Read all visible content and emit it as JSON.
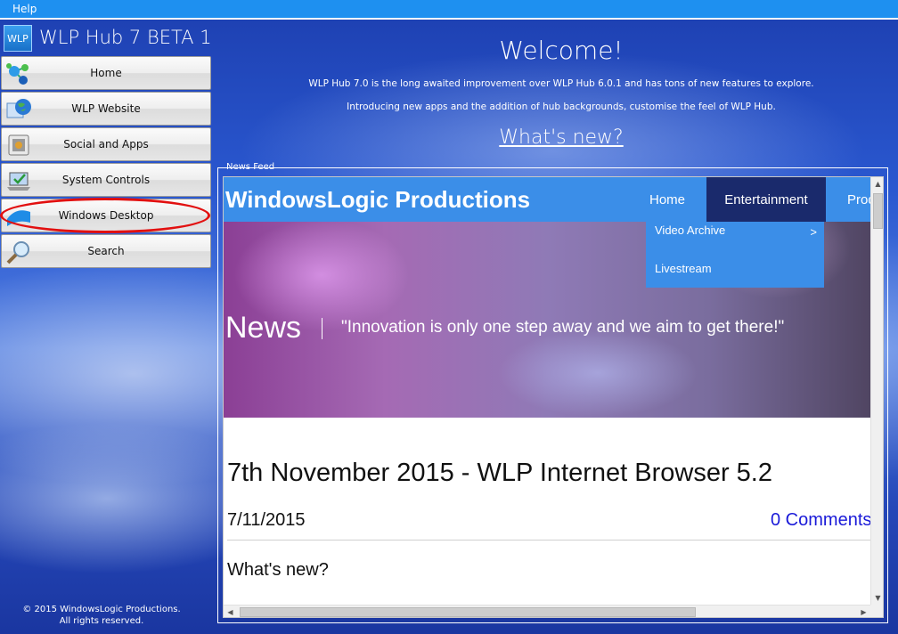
{
  "menu": {
    "help": "Help"
  },
  "app": {
    "logo_text": "WLP",
    "title": "WLP Hub 7 BETA 1"
  },
  "nav": {
    "home": "Home",
    "website": "WLP Website",
    "social": "Social and Apps",
    "system": "System Controls",
    "desktop": "Windows Desktop",
    "search": "Search"
  },
  "footer": {
    "line1": "© 2015 WindowsLogic Productions.",
    "line2": "All rights reserved."
  },
  "welcome": {
    "title": "Welcome!",
    "line1": "WLP Hub 7.0 is the long awaited improvement over WLP Hub 6.0.1 and has tons of new features to explore.",
    "line2": "Introducing new apps and the addition of hub backgrounds, customise the feel of WLP Hub.",
    "link": "What's new?"
  },
  "newsfeed": {
    "label": "News Feed",
    "site": {
      "brand": "WindowsLogic Productions",
      "tabs": [
        "Home",
        "Entertainment",
        "Prod"
      ],
      "dropdown": [
        "Video Archive",
        "Livestream"
      ],
      "dropdown_arrow": ">",
      "hero_title": "News",
      "hero_quote": "\"Innovation is only one step away and we aim to get there!\"",
      "article_title": "7th November 2015 - WLP Internet Browser 5.2",
      "article_date": "7/11/2015",
      "article_comments": "0 Comments",
      "article_sub": "What's new?"
    }
  },
  "colors": {
    "menubar": "#1e90f0",
    "site_nav": "#3b8ee8",
    "active_tab": "#1a2a6c",
    "highlight": "#e21010",
    "comments_link": "#1a1ad8"
  }
}
